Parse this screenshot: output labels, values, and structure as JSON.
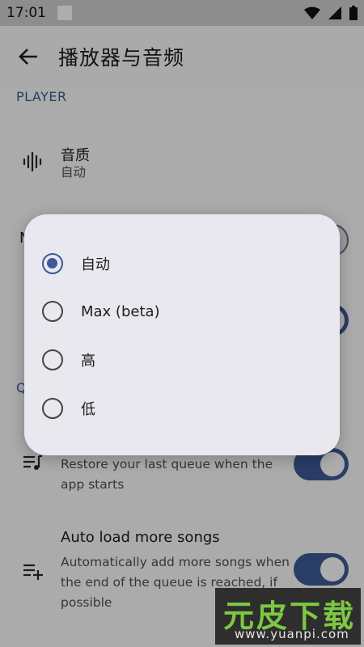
{
  "status_bar": {
    "time": "17:01"
  },
  "app_bar": {
    "title": "播放器与音频"
  },
  "sections": {
    "player": {
      "header": "PLAYER"
    },
    "queue": {
      "header": "Q"
    }
  },
  "settings": {
    "audio_quality": {
      "title": "音质",
      "summary": "自动"
    },
    "restore_queue": {
      "summary": "Restore your last queue when the app starts",
      "enabled": true
    },
    "auto_load": {
      "title": "Auto load more songs",
      "summary": "Automatically add more songs when the end of the queue is reached, if possible",
      "enabled": true
    },
    "hidden_row_1": {
      "title_letter": "N",
      "enabled": false
    },
    "hidden_row_2": {
      "title_letter": "",
      "enabled": true
    }
  },
  "dialog": {
    "options": [
      {
        "label": "自动",
        "selected": true
      },
      {
        "label": "Max (beta)",
        "selected": false
      },
      {
        "label": "高",
        "selected": false
      },
      {
        "label": "低",
        "selected": false
      }
    ]
  },
  "watermark": {
    "title": "元皮下载",
    "url": "www.yuanpi.com"
  },
  "colors": {
    "accent": "#3d5a98",
    "dialog_bg": "#e9e8ee",
    "watermark_green": "#7cc843"
  }
}
